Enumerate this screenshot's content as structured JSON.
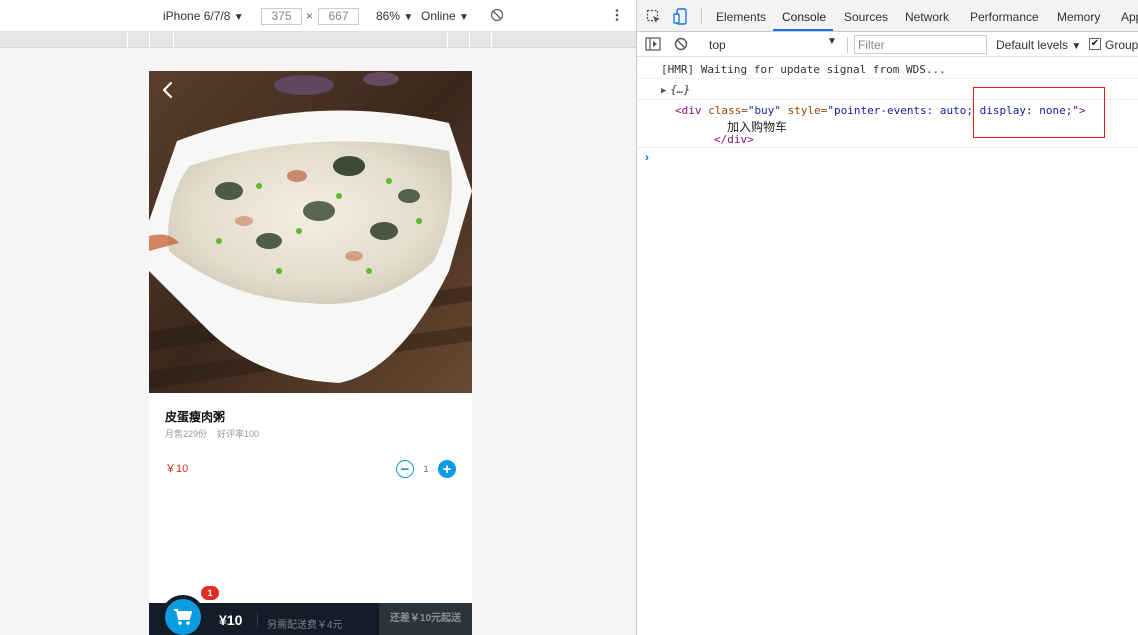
{
  "emulator": {
    "device": "iPhone 6/7/8",
    "width": "375",
    "times": "×",
    "height": "667",
    "zoom": "86%",
    "throttle": "Online"
  },
  "product": {
    "name": "皮蛋瘦肉粥",
    "monthly_sales": "月售229份",
    "rating": "好评率100",
    "price": "￥10",
    "quantity": "1",
    "minus_symbol": "−",
    "plus_symbol": "+"
  },
  "cart": {
    "badge": "1",
    "total": "¥10",
    "delivery": "另需配送费￥4元",
    "pay": "还差￥10元起送"
  },
  "devtools": {
    "tabs": [
      "Elements",
      "Console",
      "Sources",
      "Network",
      "Performance",
      "Memory",
      "App"
    ],
    "active_tab": "Console",
    "context": "top",
    "filter_placeholder": "Filter",
    "levels": "Default levels",
    "group_label": "Group",
    "group_checked": true,
    "logs": {
      "hmr": "[HMR] Waiting for update signal from WDS...",
      "object": "{…}",
      "div_open_tag": "<div",
      "class_attr": " class=",
      "class_value": "\"buy\"",
      "style_attr": " style=",
      "style_value_1": "\"pointer-events: auto; ",
      "style_value_2": "display: none;\"",
      "open_close": ">",
      "div_text": "加入购物车",
      "div_close_tag": "</div>"
    },
    "prompt": "›"
  },
  "colors": {
    "accent": "#0b9be0",
    "price_red": "#e02e24",
    "cart_bg": "#141d27",
    "highlight_box": "#e02020",
    "active_tab_underline": "#1a73e8"
  },
  "icons": {
    "back": "chevron-left-icon",
    "cart": "shopping-cart-icon",
    "inspect": "inspect-element-icon",
    "device": "device-toolbar-icon",
    "rotate": "rotate-icon",
    "more": "more-vertical-icon",
    "sidebar": "sidebar-toggle-icon",
    "clear": "clear-console-icon"
  }
}
